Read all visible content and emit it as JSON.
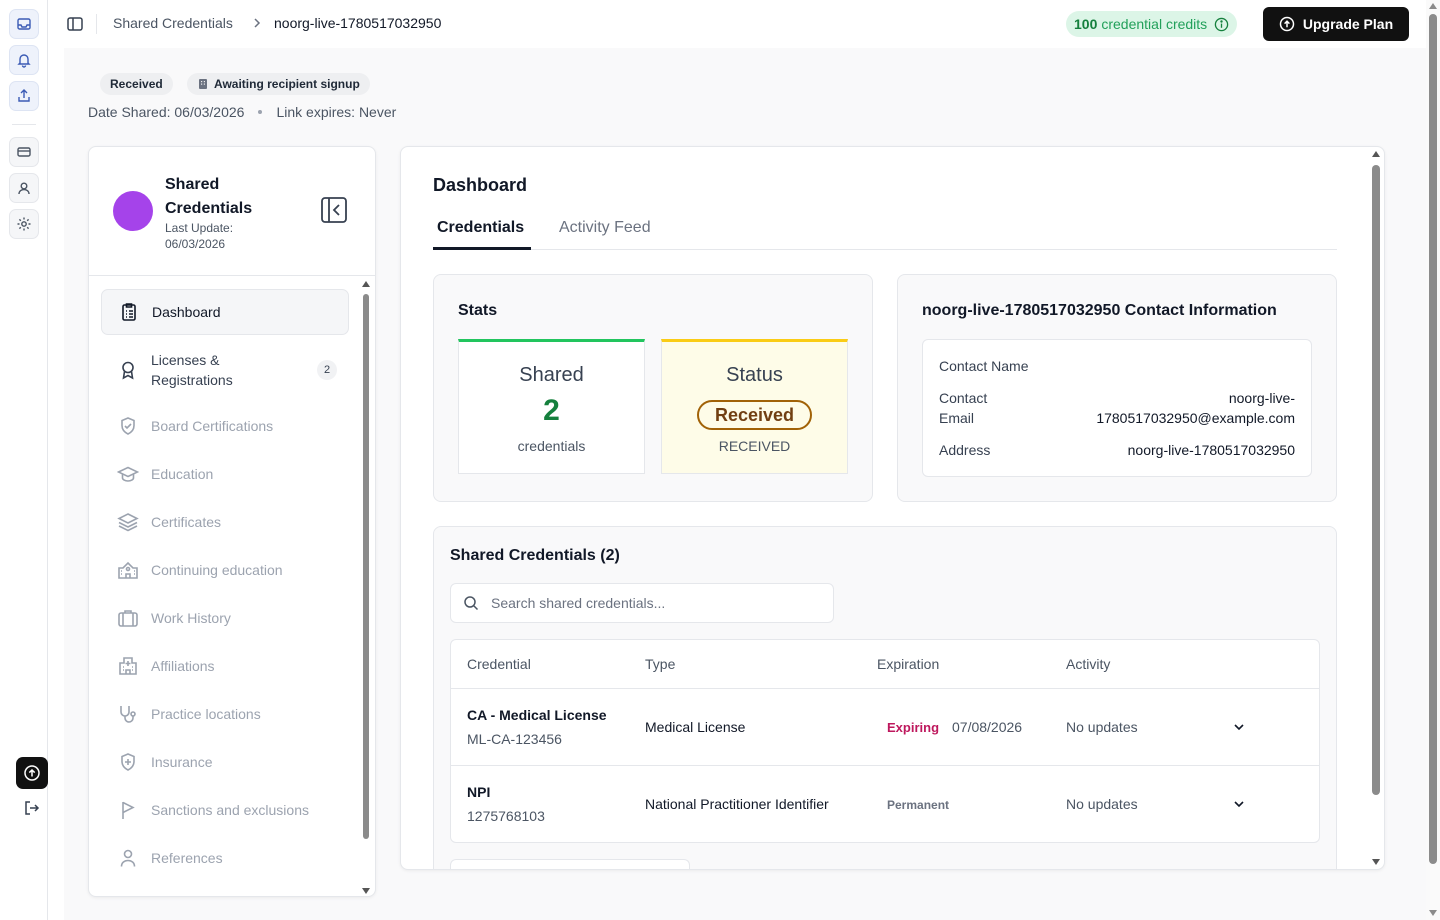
{
  "rail": {
    "icons": [
      "inbox-icon",
      "bell-icon",
      "share-upload-icon",
      "card-icon",
      "user-icon",
      "settings-icon",
      "upgrade-circle-icon",
      "logout-icon"
    ]
  },
  "header": {
    "breadcrumb_root": "Shared Credentials",
    "breadcrumb_current": "noorg-live-1780517032950",
    "credits_count": "100",
    "credits_label": "credential credits",
    "upgrade_label": "Upgrade Plan"
  },
  "share": {
    "badge_received": "Received",
    "badge_awaiting": "Awaiting recipient signup",
    "date_shared": "Date Shared: 06/03/2026",
    "link_expires": "Link expires: Never"
  },
  "sidebar": {
    "title": "Shared Credentials",
    "last_update": "Last Update: 06/03/2026",
    "avatar_color": "#a543ea",
    "items": [
      {
        "label": "Dashboard",
        "icon": "clipboard-icon",
        "active": true
      },
      {
        "label": "Licenses & Registrations",
        "icon": "award-ribbon-icon",
        "count": "2"
      },
      {
        "label": "Board Certifications",
        "icon": "shield-check-icon"
      },
      {
        "label": "Education",
        "icon": "graduation-cap-icon"
      },
      {
        "label": "Certificates",
        "icon": "layers-icon"
      },
      {
        "label": "Continuing education",
        "icon": "school-building-icon"
      },
      {
        "label": "Work History",
        "icon": "briefcase-icon"
      },
      {
        "label": "Affiliations",
        "icon": "hospital-icon"
      },
      {
        "label": "Practice locations",
        "icon": "stethoscope-icon"
      },
      {
        "label": "Insurance",
        "icon": "shield-plus-icon"
      },
      {
        "label": "Sanctions and exclusions",
        "icon": "flag-icon"
      },
      {
        "label": "References",
        "icon": "person-icon"
      }
    ]
  },
  "main": {
    "title": "Dashboard",
    "tabs": [
      {
        "label": "Credentials",
        "active": true
      },
      {
        "label": "Activity Feed",
        "active": false
      }
    ],
    "stats": {
      "title": "Stats",
      "shared_label": "Shared",
      "shared_value": "2",
      "shared_sub": "credentials",
      "status_label": "Status",
      "status_pill": "Received",
      "status_sub": "RECEIVED"
    },
    "contact": {
      "title": "noorg-live-1780517032950 Contact Information",
      "name_label": "Contact Name",
      "email_label_1": "Contact",
      "email_label_2": "Email",
      "email_value_1": "noorg-live-",
      "email_value_2": "1780517032950@example.com",
      "address_label": "Address",
      "address_value": "noorg-live-1780517032950"
    },
    "shared_credentials": {
      "title": "Shared Credentials (2)",
      "search_placeholder": "Search shared credentials...",
      "columns": [
        "Credential",
        "Type",
        "Expiration",
        "Activity"
      ],
      "rows": [
        {
          "name": "CA - Medical License",
          "id": "ML-CA-123456",
          "type": "Medical License",
          "exp_badge": "Expiring",
          "exp_date": "07/08/2026",
          "activity": "No updates"
        },
        {
          "name": "NPI",
          "id": "1275768103",
          "type": "National Practitioner Identifier",
          "exp_badge": "Permanent",
          "exp_date": "",
          "activity": "No updates"
        }
      ]
    }
  }
}
